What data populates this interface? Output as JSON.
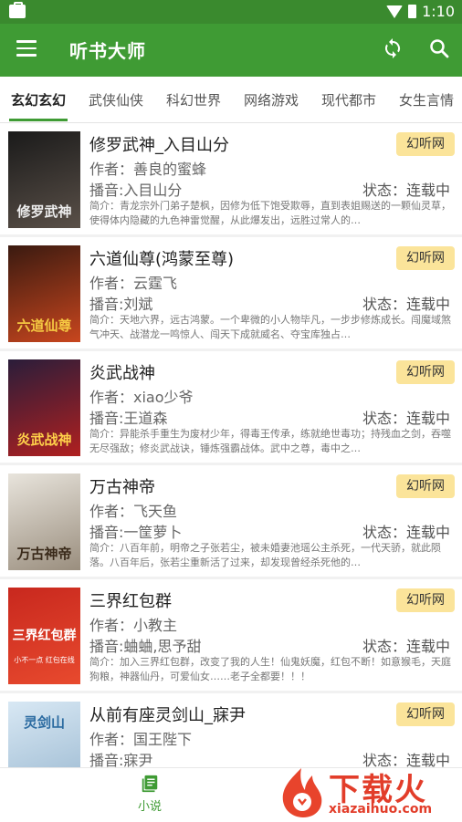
{
  "status_bar": {
    "time": "1:10"
  },
  "app": {
    "title": "听书大师"
  },
  "tabs": [
    "玄幻玄幻",
    "武侠仙侠",
    "科幻世界",
    "网络游戏",
    "现代都市",
    "女生言情"
  ],
  "books": [
    {
      "title": "修罗武神_入目山分",
      "source": "幻听网",
      "author": "作者：善良的蜜蜂",
      "narrator": "播音:入目山分",
      "status": "状态：连载中",
      "intro": "简介：青龙宗外门弟子楚枫，因修为低下饱受欺辱，直到表姐赐送的一颗仙灵草，使得体内隐藏的九色神雷觉醒，从此爆发出，远胜过常人的…",
      "cover_text": "修罗武神",
      "cover_colors": [
        "#1a1a1a",
        "#5a5048"
      ]
    },
    {
      "title": "六道仙尊(鸿蒙至尊)",
      "source": "幻听网",
      "author": "作者：云霆飞",
      "narrator": "播音:刘斌",
      "status": "状态：连载中",
      "intro": "简介：天地六界，远古鸿蒙。一个卑微的小人物毕凡，一步步修炼成长。闯魔域煞气冲天、战潜龙一鸣惊人、闯天下成就威名、夺宝库独占…",
      "cover_text": "六道仙尊",
      "cover_colors": [
        "#3a1a10",
        "#c8461e"
      ]
    },
    {
      "title": "炎武战神",
      "source": "幻听网",
      "author": "作者：xiao少爷",
      "narrator": "播音:王道森",
      "status": "状态：连载中",
      "intro": "简介：异能杀手重生为废材少年，得毒王传承，练就绝世毒功；持残血之剑，吞噬无尽强敌；修炎武战诀，锤炼强霸战体。武中之尊，毒中之…",
      "cover_text": "炎武战神",
      "cover_colors": [
        "#2a1d3a",
        "#b02020"
      ]
    },
    {
      "title": "万古神帝",
      "source": "幻听网",
      "author": "作者：飞天鱼",
      "narrator": "播音:一筐萝卜",
      "status": "状态：连载中",
      "intro": "简介：八百年前，明帝之子张若尘，被未婚妻池瑶公主杀死，一代天骄，就此陨落。八百年后，张若尘重新活了过来，却发现曾经杀死他的…",
      "cover_text": "万古神帝",
      "cover_colors": [
        "#e8e4dc",
        "#9a8e7e"
      ]
    },
    {
      "title": "三界红包群",
      "source": "幻听网",
      "author": "作者：小教主",
      "narrator": "播音:蛐蛐,思予甜",
      "status": "状态：连载中",
      "intro": "简介：加入三界红包群，改变了我的人生！仙鬼妖魔，红包不断！如意猴毛，天庭狗粮，神器仙丹，可爱仙女……老子全都要！！！",
      "cover_text": "三界红包群",
      "cover_subtext": "小不一点  红包在线",
      "cover_colors": [
        "#c8281e",
        "#e84a2e"
      ]
    },
    {
      "title": "从前有座灵剑山_寐尹",
      "source": "幻听网",
      "author": "作者：国王陛下",
      "narrator": "播音:寐尹",
      "status": "状态：连载中",
      "intro": "",
      "cover_text": "灵剑山",
      "cover_colors": [
        "#d8e8f4",
        "#9ab8d0"
      ]
    }
  ],
  "bottom_nav": {
    "label": "小说"
  },
  "watermark": {
    "text": "下载火",
    "url": "xiazaihuo.com"
  }
}
